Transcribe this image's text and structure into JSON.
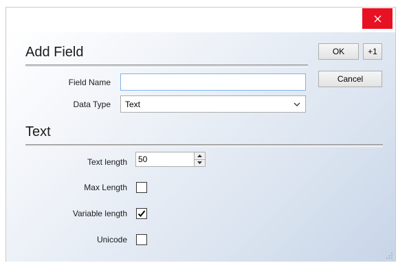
{
  "dialog": {
    "close_glyph": "×",
    "section_add_title": "Add Field",
    "section_text_title": "Text",
    "buttons": {
      "ok": "OK",
      "plus": "+1",
      "cancel": "Cancel"
    },
    "fields": {
      "field_name_label": "Field Name",
      "field_name_value": "",
      "data_type_label": "Data Type",
      "data_type_value": "Text"
    },
    "text_options": {
      "text_length_label": "Text length",
      "text_length_value": "50",
      "max_length_label": "Max Length",
      "max_length_checked": false,
      "variable_length_label": "Variable length",
      "variable_length_checked": true,
      "unicode_label": "Unicode",
      "unicode_checked": false
    }
  },
  "colors": {
    "close_button": "#e81123",
    "textbox_focus_border": "#7eb4ea"
  },
  "icons": [
    "close-icon",
    "chevron-down-icon",
    "spin-up-icon",
    "spin-down-icon",
    "checkmark-icon",
    "resize-grip-icon"
  ]
}
